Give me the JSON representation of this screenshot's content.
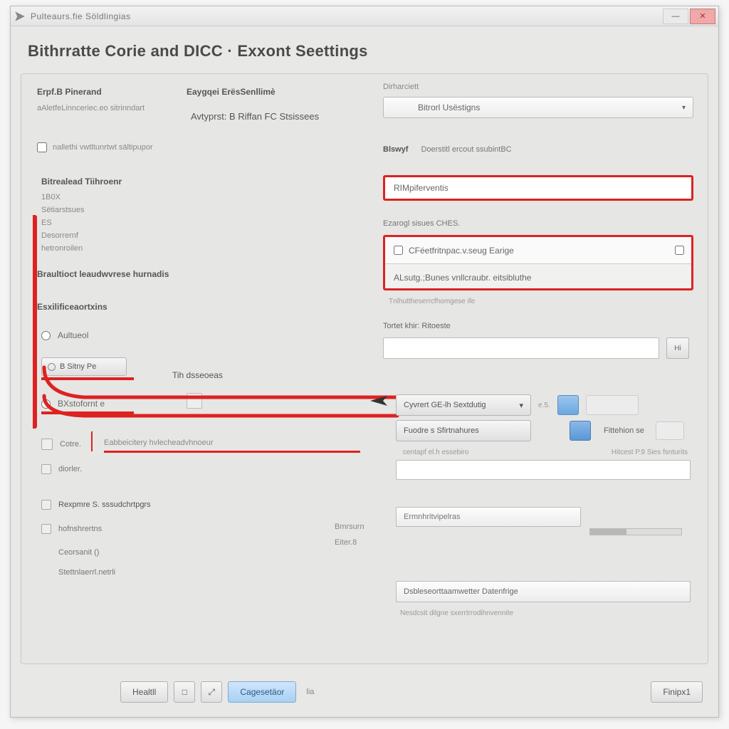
{
  "titlebar": {
    "title": "Pulteaurs.fie Söldlingias"
  },
  "header": {
    "title": "Bithrratte Corie and DICC · Exxont Seettings"
  },
  "left": {
    "section1": {
      "label": "Erpf.B Pinerand",
      "sub": "aAletfeLinnceriec.eo sitrinndart"
    },
    "section2": {
      "label": "Eaygqei ErësSenllimè",
      "sub": "Avtyprst: B Riffan FC Stsissees"
    },
    "check1": "nallethi vwtltunrtwt sältipupor",
    "group1": {
      "title": "Bitrealead Tiihroenr",
      "rows": [
        "1B0X",
        "Sëtiarstsues",
        "ES",
        "Desorrernf",
        "hetronroilen"
      ]
    },
    "brand": "Braultioct leaudwvrese hurnadis",
    "sect": "Esxilificeaortxins",
    "radio1": "Aultueol",
    "btn1": "B Sitny Pe",
    "tdsc": "Tih dsseoeas",
    "radio2": "BXstofornt e",
    "ctrlbtn": "Cotre.",
    "ctrltxt": "Eabbeicitery hvlecheadvhnoeur",
    "items": [
      "diorler.",
      "Rexpmre S. sssudchrtpgrs",
      "hofnshrertns",
      "Ceorsanit ()",
      "Stettnlaerrl.netrli"
    ],
    "pb1": "Bmrsurn",
    "pb2": "Eiter.8"
  },
  "right": {
    "lbl1": "Dirharciett",
    "dd1": "Bitrorl Usëstigns",
    "row2a": "Blswyf",
    "row2b": "Doerstitl ercout ssubintBC",
    "input1": "RIMpiferventis",
    "lbl2": "Ezarogl sisues CHES.",
    "box2row1": "CFéetfritnpac.v.seug Earige",
    "box2row2": "ALsutg.;Bunes vnllcraubr. eitsibluthe",
    "sub3": "Tnlhuttheserrcfhomgese ife",
    "lbl3": "Tortet khir: Ritoeste",
    "rb": "Hi",
    "btnrow1": {
      "btn": "Cyvrert GE-lh Sextdutig",
      "sep": "e.5."
    },
    "btnrow2": {
      "btn": "Fuodre s Sfirtnahures",
      "lab": "Fittehion se"
    },
    "sublab": "centapf el.h essebiro",
    "sublab2": "Hitcest P.9 Sies fsnturits",
    "input5": "Ermnhritvipelras",
    "input6": "Dsbleseorttaamwetter Datenfrige",
    "sub6": "Nesdcsit dilgne sxerrtrrodihnvennite"
  },
  "footer": {
    "btn1": "Healtll",
    "btn2": "□",
    "btn3": "Cagesetäor",
    "btn4": "lia",
    "btnR": "Finipx1"
  }
}
